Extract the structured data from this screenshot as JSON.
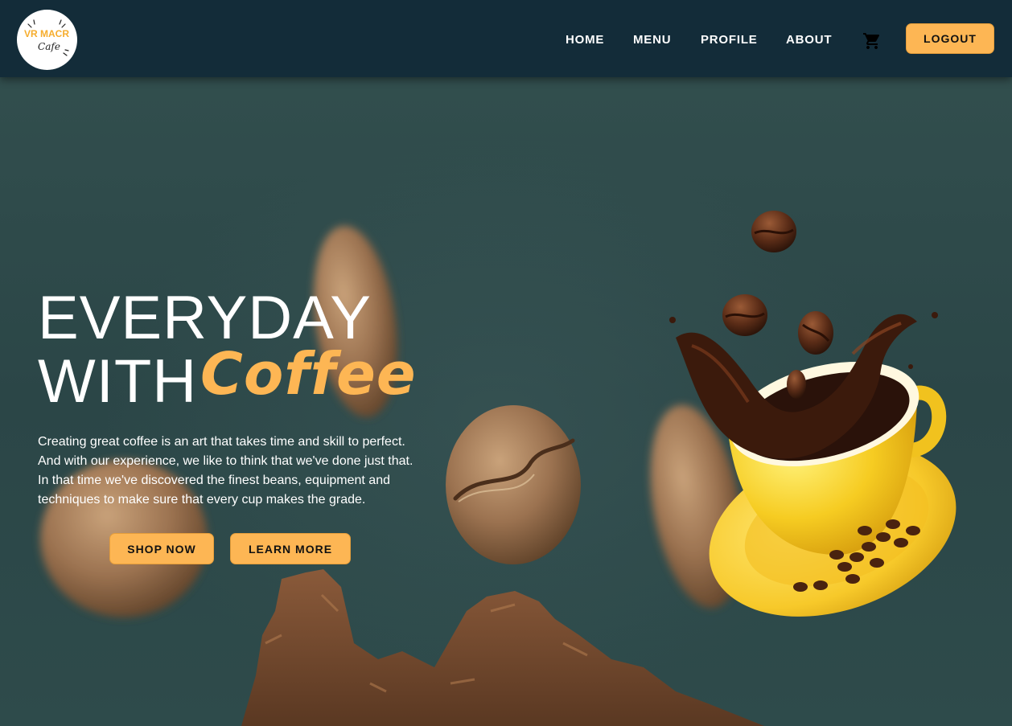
{
  "nav": {
    "logo": {
      "icon": "vr-macr-cafe-logo",
      "text_primary": "VR MACR",
      "text_secondary": "Cafe"
    },
    "links": [
      {
        "label": "HOME"
      },
      {
        "label": "MENU"
      },
      {
        "label": "PROFILE"
      },
      {
        "label": "ABOUT"
      }
    ],
    "cart_icon": "shopping-cart-icon",
    "logout_label": "LOGOUT"
  },
  "hero": {
    "headline_line1": "EVERYDAY",
    "headline_line2": "WITH",
    "headline_accent": "Coffee",
    "description_lines": [
      "Creating great coffee is an art that takes time and skill to perfect.",
      "And with our experience, we like to think that we've done just that.",
      "In that time we've discovered the finest beans, equipment and",
      "techniques to make sure that every cup makes the grade."
    ],
    "primary_cta": "SHOP NOW",
    "secondary_cta": "LEARN MORE"
  },
  "colors": {
    "navbar_bg": "#132c39",
    "hero_bg": "#2f4a4b",
    "accent": "#fdb654",
    "text_light": "#ffffff",
    "text_dark": "#111111"
  }
}
